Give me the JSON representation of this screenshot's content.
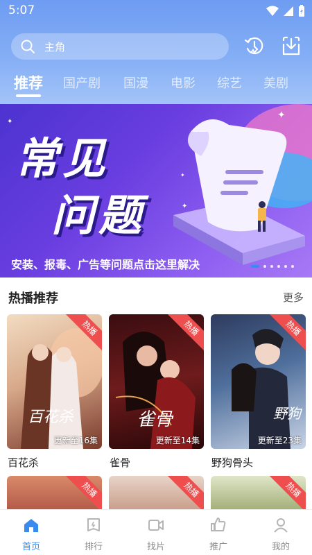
{
  "status": {
    "time": "5:07"
  },
  "search": {
    "placeholder": "主角"
  },
  "tabs": [
    {
      "label": "推荐",
      "active": true
    },
    {
      "label": "国产剧"
    },
    {
      "label": "国漫"
    },
    {
      "label": "电影"
    },
    {
      "label": "综艺"
    },
    {
      "label": "美剧"
    }
  ],
  "banner": {
    "title_line1": "常见",
    "title_line2": "问题",
    "subtitle": "安装、报毒、广告等问题点击这里解决",
    "slide_count": 6,
    "active_slide": 1
  },
  "hot_section": {
    "title": "热播推荐",
    "more_label": "更多"
  },
  "cards": [
    {
      "title": "百花杀",
      "badge": "热播",
      "progress": "更新至16集"
    },
    {
      "title": "雀骨",
      "badge": "热播",
      "progress": "更新至14集"
    },
    {
      "title": "野狗骨头",
      "badge": "热播",
      "progress": "更新至23集"
    }
  ],
  "cards_row2": [
    {
      "badge": "热播"
    },
    {
      "badge": "热播"
    },
    {
      "badge": "热播"
    }
  ],
  "bottom_nav": [
    {
      "label": "首页",
      "icon": "home-icon",
      "active": true
    },
    {
      "label": "排行",
      "icon": "ranking-icon"
    },
    {
      "label": "找片",
      "icon": "video-camera-icon"
    },
    {
      "label": "推广",
      "icon": "thumbs-up-icon"
    },
    {
      "label": "我的",
      "icon": "user-icon"
    }
  ],
  "colors": {
    "accent": "#3a8bf0",
    "badge": "#ef4e4e",
    "header": "#7ea8f4"
  }
}
